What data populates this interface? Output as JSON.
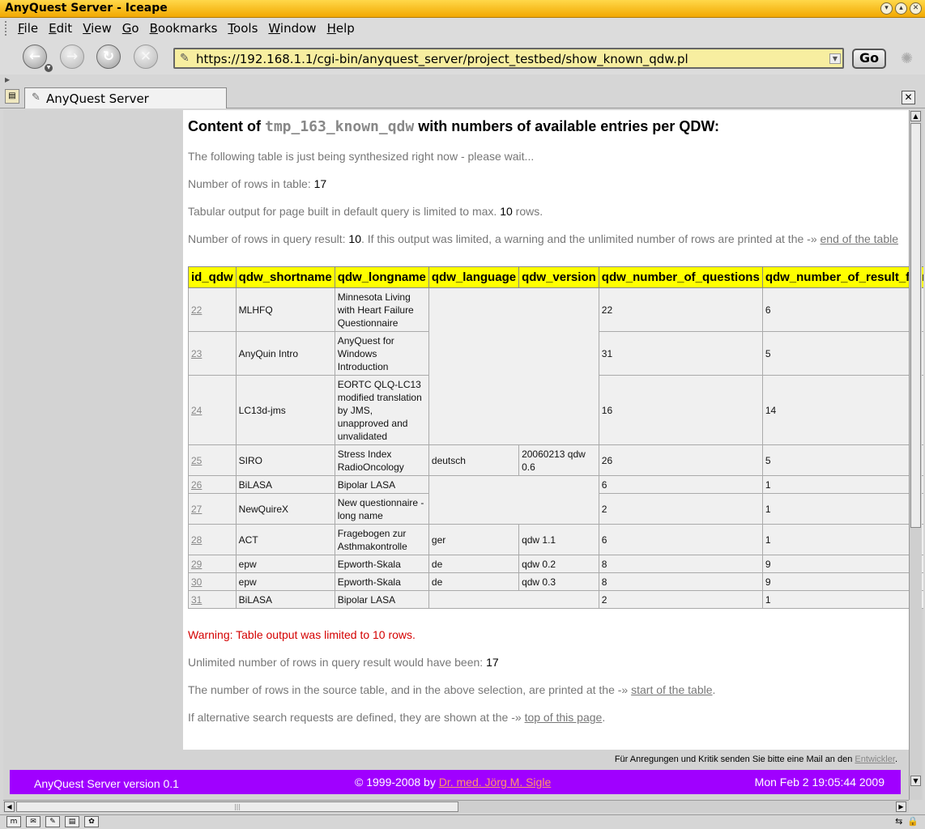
{
  "window": {
    "title": "AnyQuest Server - Iceape"
  },
  "menu": [
    {
      "pre": "",
      "u": "F",
      "post": "ile"
    },
    {
      "pre": "",
      "u": "E",
      "post": "dit"
    },
    {
      "pre": "",
      "u": "V",
      "post": "iew"
    },
    {
      "pre": "",
      "u": "G",
      "post": "o"
    },
    {
      "pre": "",
      "u": "B",
      "post": "ookmarks"
    },
    {
      "pre": "",
      "u": "T",
      "post": "ools"
    },
    {
      "pre": "",
      "u": "W",
      "post": "indow"
    },
    {
      "pre": "",
      "u": "H",
      "post": "elp"
    }
  ],
  "nav": {
    "url": "https://192.168.1.1/cgi-bin/anyquest_server/project_testbed/show_known_qdw.pl",
    "go_label": "Go"
  },
  "tab": {
    "label": "AnyQuest Server"
  },
  "page": {
    "heading_pre": "Content of ",
    "heading_code": "tmp_163_known_qdw",
    "heading_post": " with numbers of available entries per QDW:",
    "synth_text": "The following table is just being synthesized right now - please wait...",
    "rows_label": "Number of rows in table: ",
    "rows_value": "17",
    "limit_label": "Tabular output for page built in default query is limited to max. ",
    "limit_value": "10",
    "limit_suffix": " rows.",
    "result_label": "Number of rows in query result: ",
    "result_value": "10",
    "result_mid": ". If this output was limited, a warning and the unlimited number of rows are printed at the -» ",
    "result_link": "end of the table",
    "warning": "Warning: Table output was limited to 10 rows.",
    "unlimited_label": "Unlimited number of rows in query result would have been: ",
    "unlimited_value": "17",
    "source_text": "The number of rows in the source table, and in the above selection, are printed at the -» ",
    "source_link": "start of the table",
    "alt_text": "If alternative search requests are defined, they are shown at the -» ",
    "alt_link": "top of this page",
    "period": "."
  },
  "table": {
    "headers": [
      "id_qdw",
      "qdw_shortname",
      "qdw_longname",
      "qdw_language",
      "qdw_version",
      "qdw_number_of_questions",
      "qdw_number_of_result_formulas"
    ],
    "rows": [
      {
        "id": "22",
        "short": "MLHFQ",
        "long": "Minnesota Living with Heart Failure Questionnaire",
        "lang": "",
        "ver": "",
        "q": "22",
        "r": "6"
      },
      {
        "id": "23",
        "short": "AnyQuin Intro",
        "long": "AnyQuest for Windows Introduction",
        "lang": "",
        "ver": "",
        "q": "31",
        "r": "5"
      },
      {
        "id": "24",
        "short": "LC13d-jms",
        "long": "EORTC QLQ-LC13 modified translation by JMS, unapproved and unvalidated",
        "lang": "",
        "ver": "",
        "q": "16",
        "r": "14"
      },
      {
        "id": "25",
        "short": "SIRO",
        "long": "Stress Index RadioOncology",
        "lang": "deutsch",
        "ver": "20060213 qdw 0.6",
        "q": "26",
        "r": "5"
      },
      {
        "id": "26",
        "short": "BiLASA",
        "long": "Bipolar LASA",
        "lang": "",
        "ver": "",
        "q": "6",
        "r": "1"
      },
      {
        "id": "27",
        "short": "NewQuireX",
        "long": "New questionnaire - long name",
        "lang": "",
        "ver": "",
        "q": "2",
        "r": "1"
      },
      {
        "id": "28",
        "short": "ACT",
        "long": "Fragebogen zur Asthmakontrolle",
        "lang": "ger",
        "ver": "qdw 1.1",
        "q": "6",
        "r": "1"
      },
      {
        "id": "29",
        "short": "epw",
        "long": "Epworth-Skala",
        "lang": "de",
        "ver": "qdw 0.2",
        "q": "8",
        "r": "9"
      },
      {
        "id": "30",
        "short": "epw",
        "long": "Epworth-Skala",
        "lang": "de",
        "ver": "qdw 0.3",
        "q": "8",
        "r": "9"
      },
      {
        "id": "31",
        "short": "BiLASA",
        "long": "Bipolar LASA",
        "lang": "",
        "ver": "",
        "q": "2",
        "r": "1"
      }
    ]
  },
  "footer": {
    "note_pre": "Für Anregungen und Kritik senden Sie bitte eine Mail an den ",
    "note_link": "Entwickler",
    "note_post": ".",
    "version": "AnyQuest Server version 0.1",
    "copyright": "© 1999-2008 by ",
    "author_link": "Dr. med. Jörg M. Sigle",
    "datetime": "Mon Feb 2 19:05:44 2009"
  }
}
